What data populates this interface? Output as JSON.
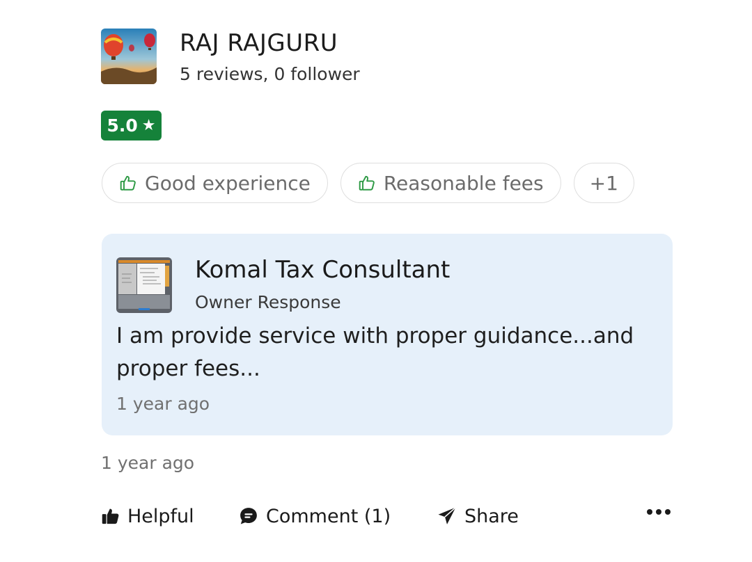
{
  "reviewer": {
    "name": "RAJ RAJGURU",
    "stats": "5 reviews, 0 follower"
  },
  "rating": {
    "value": "5.0",
    "star": "★",
    "color": "#15823a"
  },
  "tags": [
    {
      "label": "Good experience",
      "icon": "thumbs-up-outline-icon"
    },
    {
      "label": "Reasonable fees",
      "icon": "thumbs-up-outline-icon"
    },
    {
      "label": "+1"
    }
  ],
  "owner_response": {
    "business_name": "Komal Tax Consultant",
    "label": "Owner Response",
    "text": "I am provide service with proper guidance...and proper fees...",
    "time": "1 year ago",
    "background": "#e6f0fa"
  },
  "review_time": "1 year ago",
  "actions": {
    "helpful": "Helpful",
    "comment": "Comment (1)",
    "share": "Share"
  }
}
